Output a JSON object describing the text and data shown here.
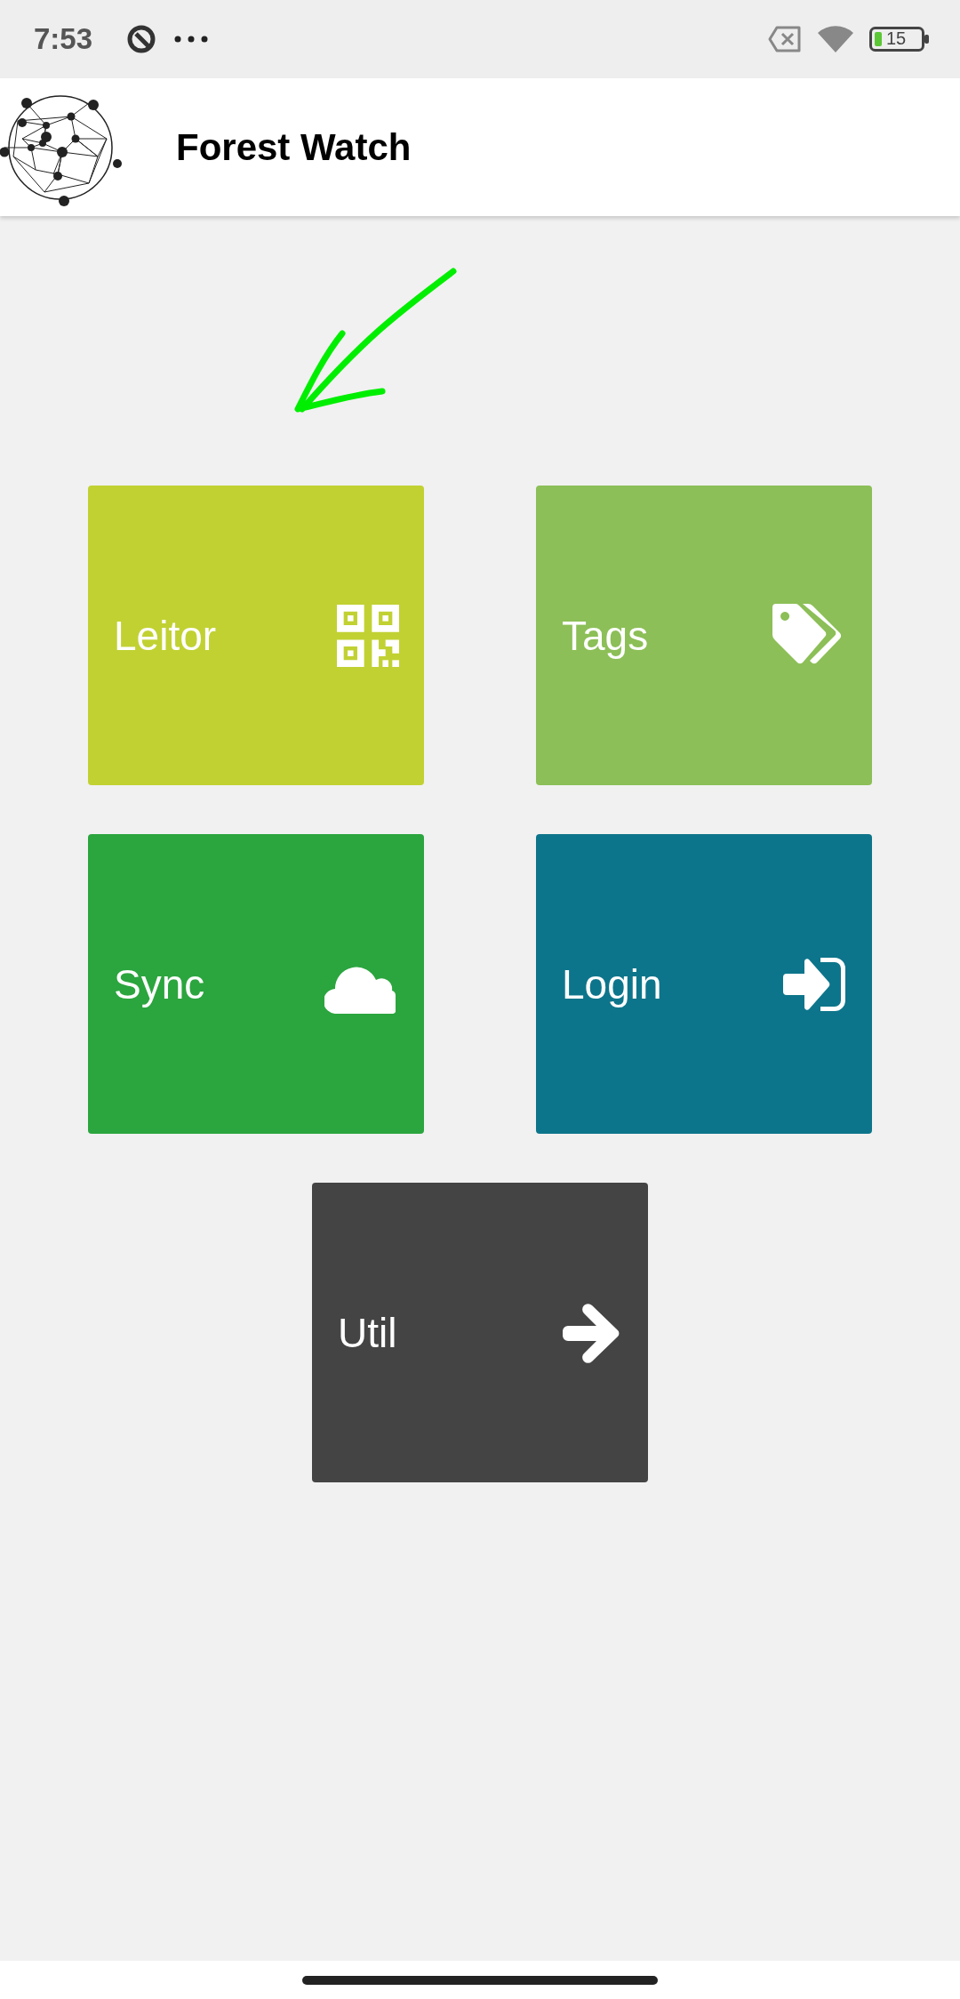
{
  "status_bar": {
    "time": "7:53",
    "battery": "15"
  },
  "app_bar": {
    "title": "Forest Watch"
  },
  "tiles": [
    {
      "label": "Leitor",
      "color": "#c1d132"
    },
    {
      "label": "Tags",
      "color": "#8cbf57"
    },
    {
      "label": "Sync",
      "color": "#2ba53e"
    },
    {
      "label": "Login",
      "color": "#0d758b"
    },
    {
      "label": "Util",
      "color": "#444444"
    }
  ]
}
